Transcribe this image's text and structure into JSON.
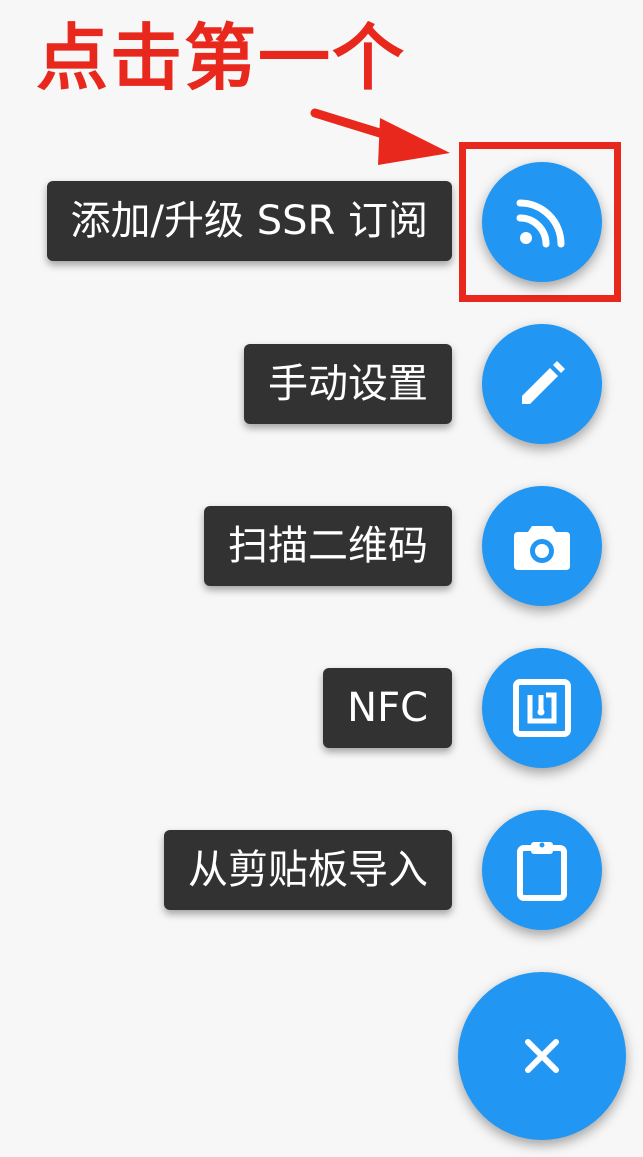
{
  "annotation": {
    "text": "点击第一个",
    "color": "#e8281c"
  },
  "menu": {
    "accent_color": "#2196f3",
    "items": [
      {
        "label": "添加/升级 SSR 订阅",
        "icon": "rss-icon"
      },
      {
        "label": "手动设置",
        "icon": "pencil-icon"
      },
      {
        "label": "扫描二维码",
        "icon": "camera-icon"
      },
      {
        "label": "NFC",
        "icon": "nfc-icon"
      },
      {
        "label": "从剪贴板导入",
        "icon": "clipboard-icon"
      }
    ],
    "close_icon": "close-icon"
  }
}
